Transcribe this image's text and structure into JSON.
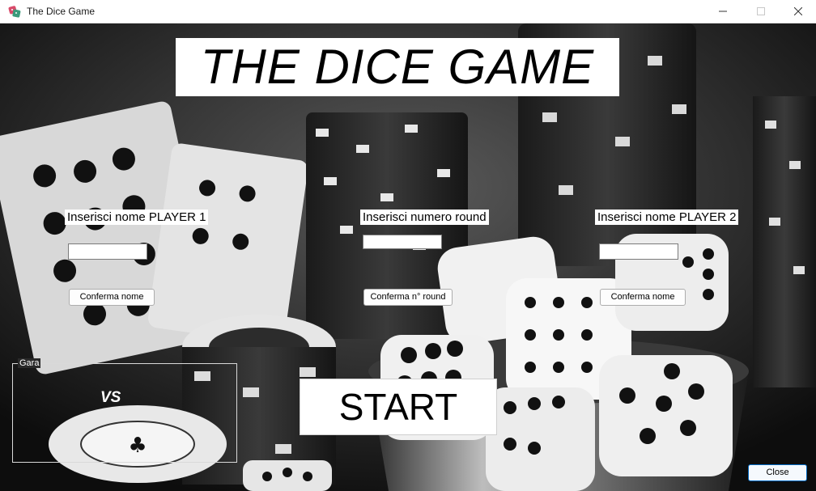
{
  "window": {
    "title": "The Dice Game",
    "minimize_icon": "minimize-icon",
    "maximize_icon": "maximize-icon",
    "close_icon": "close-icon"
  },
  "main": {
    "title": "THE DICE GAME",
    "player1": {
      "label": "Inserisci nome PLAYER 1",
      "value": "",
      "confirm_label": "Conferma nome"
    },
    "rounds": {
      "label": "Inserisci numero round",
      "value": "",
      "confirm_label": "Conferma n° round"
    },
    "player2": {
      "label": "Inserisci nome PLAYER 2",
      "value": "",
      "confirm_label": "Conferma nome"
    },
    "group": {
      "legend": "Gara",
      "vs": "VS"
    },
    "start_label": "START",
    "close_label": "Close"
  },
  "colors": {
    "background": "#141414",
    "accent": "#0067c0",
    "panel": "#ffffff"
  }
}
